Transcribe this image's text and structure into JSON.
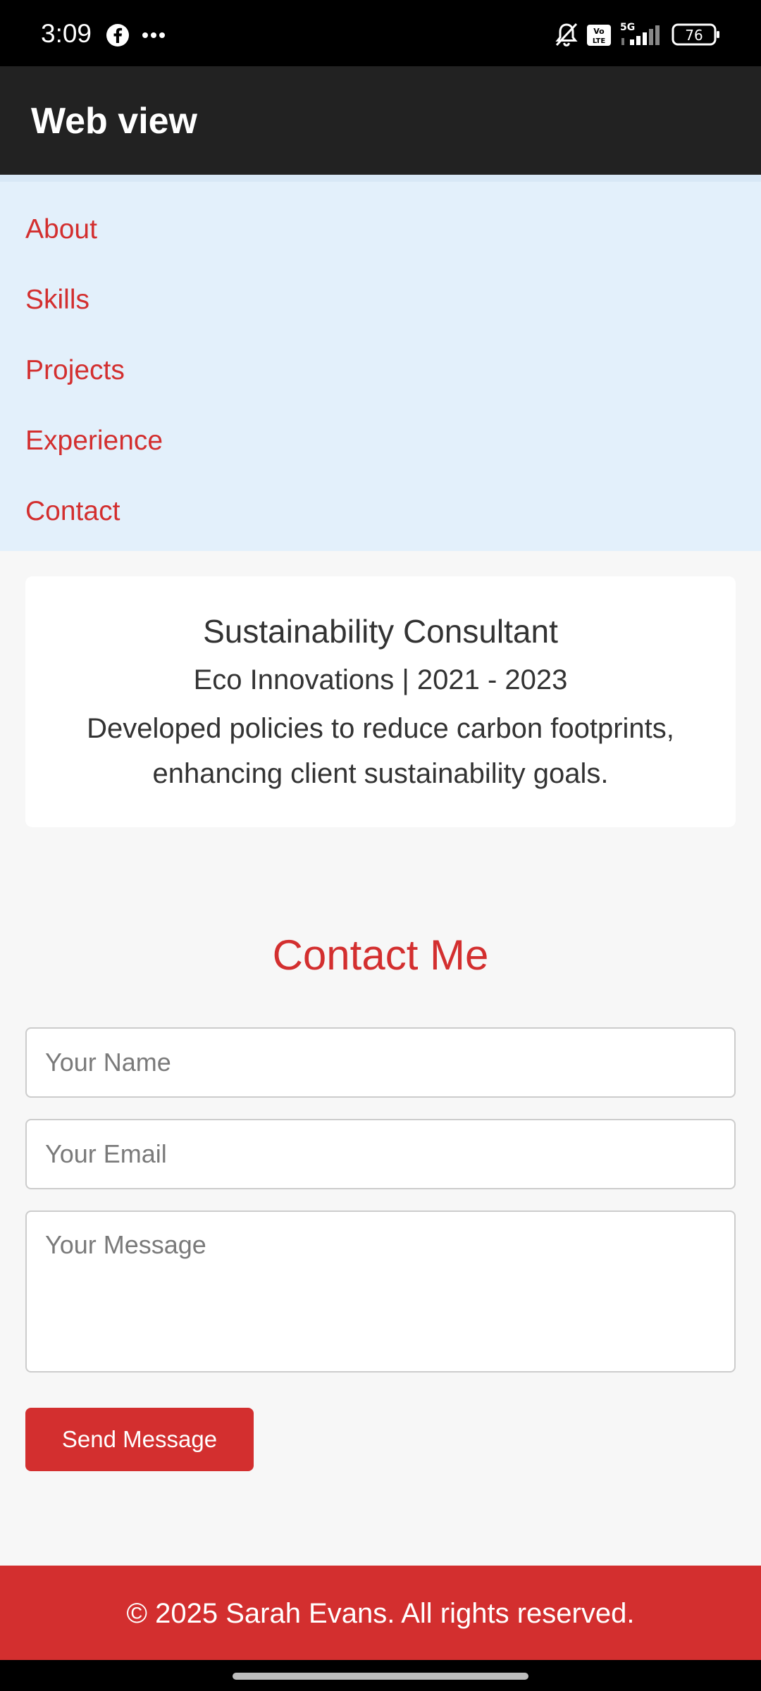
{
  "status_bar": {
    "time": "3:09",
    "battery": "76",
    "network": "5G",
    "icons": [
      "facebook-icon",
      "more-icon",
      "bell-off-icon",
      "volte-icon",
      "signal-icon",
      "battery-icon"
    ]
  },
  "app_bar": {
    "title": "Web view"
  },
  "nav": {
    "items": [
      {
        "label": "About"
      },
      {
        "label": "Skills"
      },
      {
        "label": "Projects"
      },
      {
        "label": "Experience"
      },
      {
        "label": "Contact"
      }
    ]
  },
  "experience": {
    "title": "Sustainability Consultant",
    "company": "Eco Innovations | 2021 - 2023",
    "description": "Developed policies to reduce carbon footprints, enhancing client sustainability goals."
  },
  "contact": {
    "heading": "Contact Me",
    "name_placeholder": "Your Name",
    "email_placeholder": "Your Email",
    "message_placeholder": "Your Message",
    "send_label": "Send Message"
  },
  "footer": {
    "text": "© 2025 Sarah Evans. All rights reserved."
  },
  "colors": {
    "accent": "#d32f2f",
    "nav_bg": "#e3f0fb",
    "app_bar_bg": "#222222",
    "page_bg": "#f7f7f7"
  }
}
